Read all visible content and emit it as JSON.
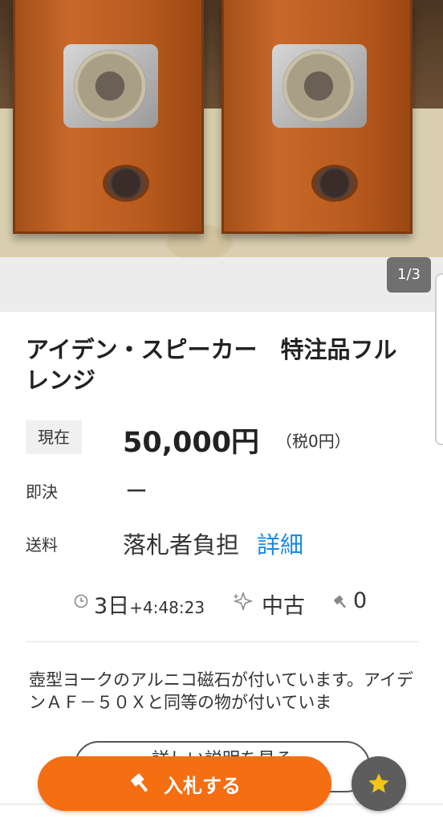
{
  "gallery": {
    "counter": "1/3"
  },
  "item": {
    "title": "アイデン・スピーカー　特注品フルレンジ"
  },
  "price": {
    "current_label": "現在",
    "current_value": "50,000円",
    "tax": "（税0円）",
    "buyout_label": "即決",
    "buyout_value": "ー",
    "shipping_label": "送料",
    "shipping_value": "落札者負担",
    "shipping_detail_link": "詳細"
  },
  "meta": {
    "time_days": "3日",
    "time_rest": "+4:48:23",
    "condition": "中古",
    "bids": "0"
  },
  "description": {
    "text": "壺型ヨークのアルニコ磁石が付いています。アイデンＡＦ－５０Ｘと同等の物が付いていま",
    "more_button": "詳しい説明を見る"
  },
  "actions": {
    "bid_label": "入札する"
  },
  "colors": {
    "accent": "#f56e11",
    "link": "#1a8ae6",
    "fav_bg": "#5d5d5d",
    "star": "#f5c518"
  }
}
